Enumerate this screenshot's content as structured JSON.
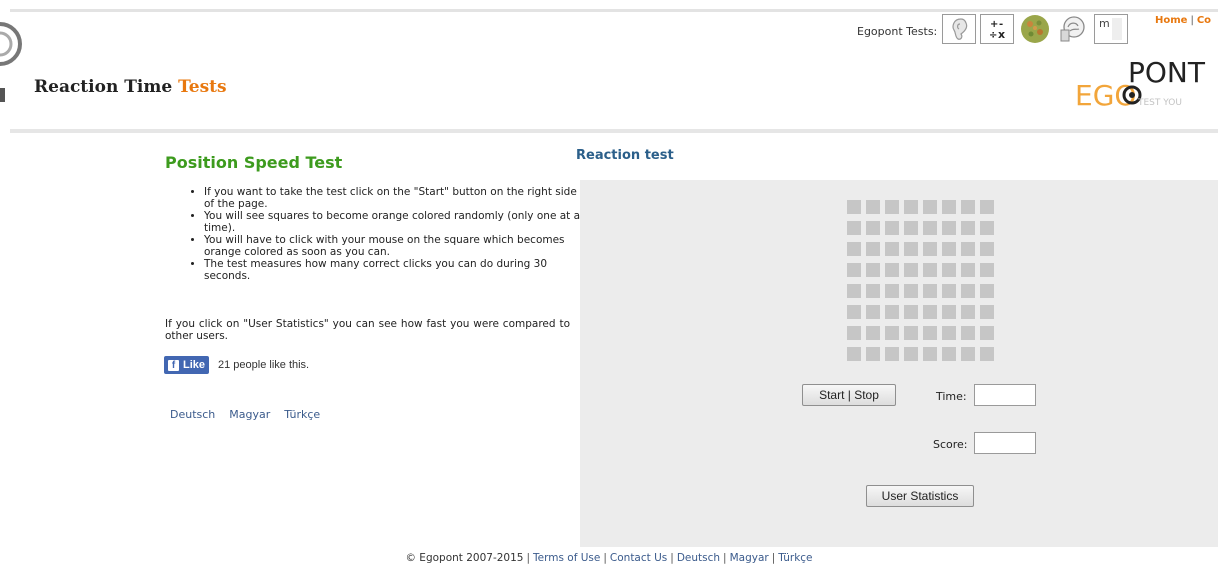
{
  "header": {
    "site_title_main": "Reaction Time",
    "site_title_accent": "Tests",
    "egopont_tests_label": "Egopont Tests:",
    "test_icons": [
      "ear-icon",
      "math-operators-icon",
      "color-vision-icon",
      "brain-icon",
      "memory-icon"
    ],
    "math_icon_text": "+ -\n÷ x",
    "memory_icon_text": "m",
    "top_links": [
      "Home",
      "Co"
    ],
    "egopont_logo": {
      "ego": "EGO",
      "pont": "PONT",
      "tagline": "TEST YOU"
    }
  },
  "left": {
    "title": "Position Speed Test",
    "instructions": [
      "If you want to take the test click on the \"Start\" button on the right side of the page.",
      "You will see squares to become orange colored randomly (only one at a time).",
      "You will have to click with your mouse on the square which becomes orange colored as soon as you can.",
      "The test measures how many correct clicks you can do during 30 seconds."
    ],
    "stats_note": "If you click on \"User Statistics\" you can see how fast you were compared to other users.",
    "like_button": "Like",
    "like_count": "21 people like this.",
    "languages": [
      "Deutsch",
      "Magyar",
      "Türkçe"
    ]
  },
  "right": {
    "title": "Reaction test",
    "grid": {
      "rows": 8,
      "cols": 8
    },
    "start_stop_label": "Start | Stop",
    "time_label": "Time:",
    "time_value": "",
    "score_label": "Score:",
    "score_value": "",
    "user_statistics_label": "User Statistics"
  },
  "footer": {
    "copyright": "© Egopont 2007-2015",
    "links": [
      "Terms of Use",
      "Contact Us",
      "Deutsch",
      "Magyar",
      "Türkçe"
    ]
  },
  "colors": {
    "title_green": "#3d9b1e",
    "accent_orange": "#e8780f",
    "heading_blue": "#2b5f8a",
    "link_blue": "#3b5b8c",
    "panel_gray": "#ececec",
    "square_gray": "#c6c6c6",
    "facebook_blue": "#4267b2"
  }
}
